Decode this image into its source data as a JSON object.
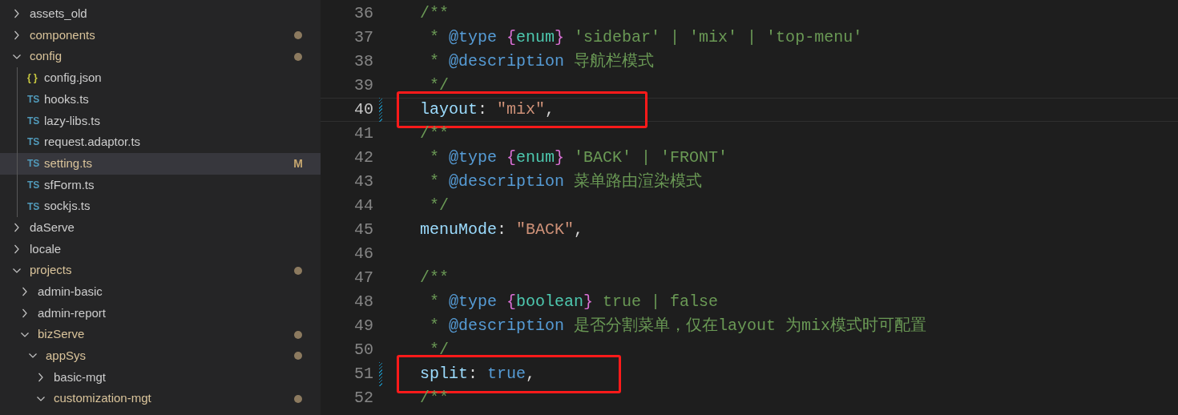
{
  "explorer": {
    "items": [
      {
        "kind": "folder",
        "name": "assets_old",
        "expanded": false
      },
      {
        "kind": "folder",
        "name": "components",
        "expanded": false,
        "modified": true
      },
      {
        "kind": "folder",
        "name": "config",
        "expanded": true,
        "modified": true,
        "children": [
          {
            "kind": "file",
            "icon": "{ }",
            "name": "config.json"
          },
          {
            "kind": "file",
            "icon": "TS",
            "name": "hooks.ts"
          },
          {
            "kind": "file",
            "icon": "TS",
            "name": "lazy-libs.ts"
          },
          {
            "kind": "file",
            "icon": "TS",
            "name": "request.adaptor.ts"
          },
          {
            "kind": "file",
            "icon": "TS",
            "name": "setting.ts",
            "selected": true,
            "badge": "M"
          },
          {
            "kind": "file",
            "icon": "TS",
            "name": "sfForm.ts"
          },
          {
            "kind": "file",
            "icon": "TS",
            "name": "sockjs.ts"
          }
        ]
      },
      {
        "kind": "folder",
        "name": "daServe",
        "expanded": false
      },
      {
        "kind": "folder",
        "name": "locale",
        "expanded": false
      },
      {
        "kind": "folder",
        "name": "projects",
        "expanded": true,
        "modified": true,
        "children": [
          {
            "kind": "folder",
            "name": "admin-basic",
            "expanded": false
          },
          {
            "kind": "folder",
            "name": "admin-report",
            "expanded": false
          },
          {
            "kind": "folder",
            "name": "bizServe",
            "expanded": true,
            "modified": true,
            "children": [
              {
                "kind": "folder",
                "name": "appSys",
                "expanded": true,
                "modified": true,
                "children": [
                  {
                    "kind": "folder",
                    "name": "basic-mgt",
                    "expanded": false
                  },
                  {
                    "kind": "folder",
                    "name": "customization-mgt",
                    "expanded": true,
                    "modified": true
                  }
                ]
              }
            ]
          }
        ]
      }
    ]
  },
  "editor": {
    "lines": [
      {
        "number": "36",
        "kind": "doc-start",
        "tokens": [
          {
            "kind": "comment",
            "text": "/**"
          }
        ]
      },
      {
        "number": "37",
        "kind": "doc-body",
        "tokens": [
          {
            "kind": "comment",
            "text": "* "
          },
          {
            "kind": "tag",
            "text": "@type "
          },
          {
            "kind": "brace",
            "text": "{"
          },
          {
            "kind": "type",
            "text": "enum"
          },
          {
            "kind": "brace",
            "text": "}"
          },
          {
            "kind": "comment",
            "text": " 'sidebar' | 'mix' | 'top-menu'"
          }
        ]
      },
      {
        "number": "38",
        "kind": "doc-body",
        "tokens": [
          {
            "kind": "comment",
            "text": "* "
          },
          {
            "kind": "tag",
            "text": "@description"
          },
          {
            "kind": "comment",
            "text": " 导航栏模式"
          }
        ]
      },
      {
        "number": "39",
        "kind": "doc-body",
        "tokens": [
          {
            "kind": "comment",
            "text": "*/"
          }
        ]
      },
      {
        "number": "40",
        "kind": "code",
        "current": true,
        "modified": true,
        "highlighted": true,
        "tokens": [
          {
            "kind": "prop",
            "text": "layout"
          },
          {
            "kind": "plain",
            "text": ": "
          },
          {
            "kind": "string",
            "text": "\"mix\""
          },
          {
            "kind": "plain",
            "text": ","
          }
        ]
      },
      {
        "number": "41",
        "kind": "doc-start",
        "tokens": [
          {
            "kind": "comment",
            "text": "/**"
          }
        ]
      },
      {
        "number": "42",
        "kind": "doc-body",
        "tokens": [
          {
            "kind": "comment",
            "text": "* "
          },
          {
            "kind": "tag",
            "text": "@type "
          },
          {
            "kind": "brace",
            "text": "{"
          },
          {
            "kind": "type",
            "text": "enum"
          },
          {
            "kind": "brace",
            "text": "}"
          },
          {
            "kind": "comment",
            "text": " 'BACK' | 'FRONT'"
          }
        ]
      },
      {
        "number": "43",
        "kind": "doc-body",
        "tokens": [
          {
            "kind": "comment",
            "text": "* "
          },
          {
            "kind": "tag",
            "text": "@description"
          },
          {
            "kind": "comment",
            "text": " 菜单路由渲染模式"
          }
        ]
      },
      {
        "number": "44",
        "kind": "doc-body",
        "tokens": [
          {
            "kind": "comment",
            "text": "*/"
          }
        ]
      },
      {
        "number": "45",
        "kind": "code",
        "tokens": [
          {
            "kind": "prop",
            "text": "menuMode"
          },
          {
            "kind": "plain",
            "text": ": "
          },
          {
            "kind": "string",
            "text": "\"BACK\""
          },
          {
            "kind": "plain",
            "text": ","
          }
        ]
      },
      {
        "number": "46",
        "kind": "blank"
      },
      {
        "number": "47",
        "kind": "doc-start",
        "tokens": [
          {
            "kind": "comment",
            "text": "/**"
          }
        ]
      },
      {
        "number": "48",
        "kind": "doc-body",
        "tokens": [
          {
            "kind": "comment",
            "text": "* "
          },
          {
            "kind": "tag",
            "text": "@type "
          },
          {
            "kind": "brace",
            "text": "{"
          },
          {
            "kind": "type",
            "text": "boolean"
          },
          {
            "kind": "brace",
            "text": "}"
          },
          {
            "kind": "comment",
            "text": " true | false"
          }
        ]
      },
      {
        "number": "49",
        "kind": "doc-body",
        "tokens": [
          {
            "kind": "comment",
            "text": "* "
          },
          {
            "kind": "tag",
            "text": "@description"
          },
          {
            "kind": "comment",
            "text": " 是否分割菜单，仅在layout 为mix模式时可配置"
          }
        ]
      },
      {
        "number": "50",
        "kind": "doc-body",
        "tokens": [
          {
            "kind": "comment",
            "text": "*/"
          }
        ]
      },
      {
        "number": "51",
        "kind": "code",
        "modified": true,
        "highlighted": true,
        "tokens": [
          {
            "kind": "prop",
            "text": "split"
          },
          {
            "kind": "plain",
            "text": ": "
          },
          {
            "kind": "bool",
            "text": "true"
          },
          {
            "kind": "plain",
            "text": ","
          }
        ]
      },
      {
        "number": "52",
        "kind": "doc-start",
        "tokens": [
          {
            "kind": "comment",
            "text": "/**"
          }
        ]
      }
    ]
  }
}
